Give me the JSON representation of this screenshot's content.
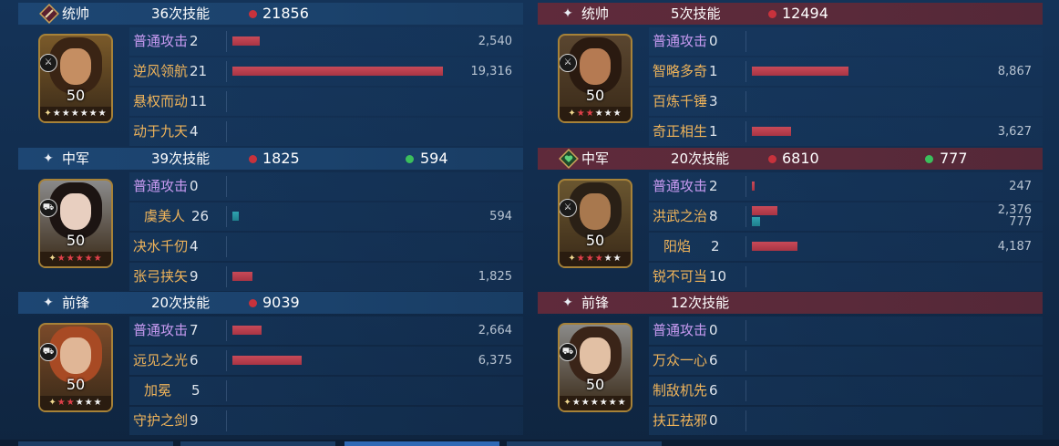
{
  "panels": [
    {
      "id": "l0",
      "side": "left",
      "theme": "blue",
      "role": "统帅",
      "role_icon": "diamond-sword-icon",
      "skills": "36次技能",
      "damage": "21856",
      "heal": null,
      "level": "50",
      "stars": {
        "red": 0,
        "white": 6
      },
      "weapon_icon": "sword-icon",
      "colors": {
        "face": "#c58e62",
        "hair": "#3a2414",
        "bg": "#7a5a2a"
      },
      "rows": [
        {
          "name": "普通攻击",
          "count": "2",
          "purple": true,
          "bars": [
            {
              "type": "red",
              "value": 2540
            }
          ],
          "nums": [
            "2,540"
          ]
        },
        {
          "name": "逆风领航",
          "count": "21",
          "purple": false,
          "bars": [
            {
              "type": "red",
              "value": 19316
            }
          ],
          "nums": [
            "19,316"
          ]
        },
        {
          "name": "悬权而动",
          "count": "11",
          "purple": false,
          "bars": [],
          "nums": []
        },
        {
          "name": "动于九天",
          "count": "4",
          "purple": false,
          "bars": [],
          "nums": []
        }
      ]
    },
    {
      "id": "r0",
      "side": "right",
      "theme": "red",
      "role": "统帅",
      "role_icon": "sparkle-icon",
      "skills": "5次技能",
      "damage": "12494",
      "heal": null,
      "level": "50",
      "stars": {
        "red": 2,
        "white": 3
      },
      "weapon_icon": "sword-icon",
      "colors": {
        "face": "#b57a52",
        "hair": "#2a1a10",
        "bg": "#5a4630"
      },
      "rows": [
        {
          "name": "普通攻击",
          "count": "0",
          "purple": true,
          "bars": [],
          "nums": []
        },
        {
          "name": "智略多奇",
          "count": "1",
          "purple": false,
          "bars": [
            {
              "type": "red",
              "value": 8867
            }
          ],
          "nums": [
            "8,867"
          ]
        },
        {
          "name": "百炼千锤",
          "count": "3",
          "purple": false,
          "bars": [],
          "nums": []
        },
        {
          "name": "奇正相生",
          "count": "1",
          "purple": false,
          "bars": [
            {
              "type": "red",
              "value": 3627
            }
          ],
          "nums": [
            "3,627"
          ]
        }
      ]
    },
    {
      "id": "l1",
      "side": "left",
      "theme": "blue",
      "role": "中军",
      "role_icon": "sparkle-icon",
      "skills": "39次技能",
      "damage": "1825",
      "heal": "594",
      "level": "50",
      "stars": {
        "red": 5,
        "white": 0
      },
      "weapon_icon": "chariot-icon",
      "colors": {
        "face": "#e8cfc0",
        "hair": "#1c1412",
        "bg": "#8a8a8a"
      },
      "rows": [
        {
          "name": "普通攻击",
          "count": "0",
          "purple": true,
          "bars": [],
          "nums": []
        },
        {
          "name": "虞美人",
          "count": "26",
          "purple": false,
          "indent": true,
          "bars": [
            {
              "type": "teal",
              "value": 594
            }
          ],
          "nums": [
            "594"
          ]
        },
        {
          "name": "决水千仞",
          "count": "4",
          "purple": false,
          "bars": [],
          "nums": []
        },
        {
          "name": "张弓挟矢",
          "count": "9",
          "purple": false,
          "bars": [
            {
              "type": "red",
              "value": 1825
            }
          ],
          "nums": [
            "1,825"
          ]
        }
      ]
    },
    {
      "id": "r1",
      "side": "right",
      "theme": "red",
      "role": "中军",
      "role_icon": "heart-shield-icon",
      "skills": "20次技能",
      "damage": "6810",
      "heal": "777",
      "level": "50",
      "stars": {
        "red": 3,
        "white": 2
      },
      "weapon_icon": "sword-icon",
      "colors": {
        "face": "#a8784e",
        "hair": "#2a2016",
        "bg": "#6a5630"
      },
      "rows": [
        {
          "name": "普通攻击",
          "count": "2",
          "purple": true,
          "bars": [
            {
              "type": "red",
              "value": 247
            }
          ],
          "nums": [
            "247"
          ]
        },
        {
          "name": "洪武之治",
          "count": "8",
          "purple": false,
          "bars": [
            {
              "type": "red",
              "value": 2376
            },
            {
              "type": "teal",
              "value": 777
            }
          ],
          "nums": [
            "2,376",
            "777"
          ]
        },
        {
          "name": "阳焰",
          "count": "2",
          "purple": false,
          "indent": true,
          "bars": [
            {
              "type": "red",
              "value": 4187
            }
          ],
          "nums": [
            "4,187"
          ]
        },
        {
          "name": "锐不可当",
          "count": "10",
          "purple": false,
          "bars": [],
          "nums": []
        }
      ]
    },
    {
      "id": "l2",
      "side": "left",
      "theme": "blue",
      "role": "前锋",
      "role_icon": "sparkle-icon",
      "skills": "20次技能",
      "damage": "9039",
      "heal": null,
      "level": "50",
      "stars": {
        "red": 2,
        "white": 3
      },
      "weapon_icon": "chariot-icon",
      "colors": {
        "face": "#e0b696",
        "hair": "#a84a24",
        "bg": "#7a4a2a"
      },
      "rows": [
        {
          "name": "普通攻击",
          "count": "7",
          "purple": true,
          "bars": [
            {
              "type": "red",
              "value": 2664
            }
          ],
          "nums": [
            "2,664"
          ]
        },
        {
          "name": "远见之光",
          "count": "6",
          "purple": false,
          "bars": [
            {
              "type": "red",
              "value": 6375
            }
          ],
          "nums": [
            "6,375"
          ]
        },
        {
          "name": "加冕",
          "count": "5",
          "purple": false,
          "indent": true,
          "bars": [],
          "nums": []
        },
        {
          "name": "守护之剑",
          "count": "9",
          "purple": false,
          "bars": [],
          "nums": []
        }
      ]
    },
    {
      "id": "r2",
      "side": "right",
      "theme": "red",
      "role": "前锋",
      "role_icon": "sparkle-icon",
      "skills": "12次技能",
      "damage": null,
      "heal": null,
      "level": "50",
      "stars": {
        "red": 0,
        "white": 6
      },
      "weapon_icon": "chariot-icon",
      "colors": {
        "face": "#e2c0a4",
        "hair": "#3a2418",
        "bg": "#8a8a88"
      },
      "rows": [
        {
          "name": "普通攻击",
          "count": "0",
          "purple": true,
          "bars": [],
          "nums": []
        },
        {
          "name": "万众一心",
          "count": "6",
          "purple": false,
          "bars": [],
          "nums": []
        },
        {
          "name": "制敌机先",
          "count": "6",
          "purple": false,
          "bars": [],
          "nums": []
        },
        {
          "name": "扶正祛邪",
          "count": "0",
          "purple": false,
          "bars": [],
          "nums": []
        }
      ]
    }
  ],
  "bar_scale_max": 19316,
  "icon_glyphs": {
    "sparkle-icon": "✦",
    "diamond-sword-icon": "⚔",
    "heart-shield-icon": "♥",
    "sword-icon": "⚔",
    "chariot-icon": "⛟"
  }
}
